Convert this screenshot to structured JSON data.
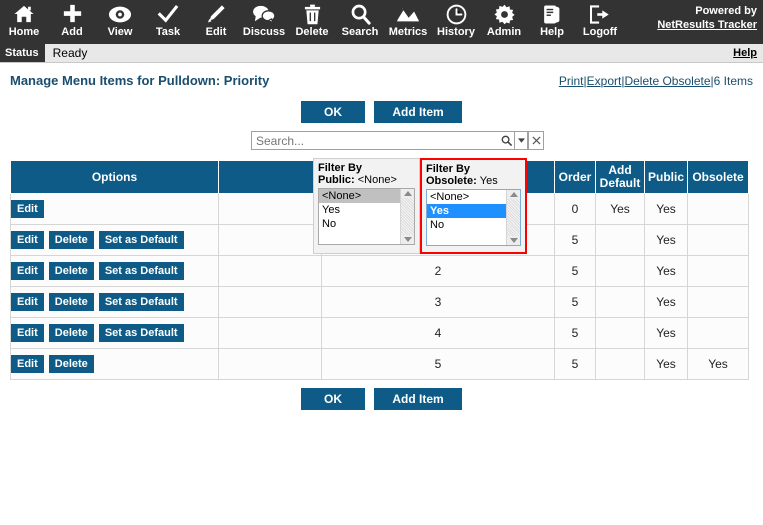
{
  "toolbar": {
    "items": [
      {
        "label": "Home",
        "icon": "home-icon"
      },
      {
        "label": "Add",
        "icon": "plus-icon"
      },
      {
        "label": "View",
        "icon": "eye-icon"
      },
      {
        "label": "Task",
        "icon": "check-icon"
      },
      {
        "label": "Edit",
        "icon": "pencil-icon"
      },
      {
        "label": "Discuss",
        "icon": "speech-bubbles-icon"
      },
      {
        "label": "Delete",
        "icon": "trash-icon"
      },
      {
        "label": "Search",
        "icon": "magnifier-icon"
      },
      {
        "label": "Metrics",
        "icon": "chart-line-icon"
      },
      {
        "label": "History",
        "icon": "clock-icon"
      },
      {
        "label": "Admin",
        "icon": "gear-icon"
      },
      {
        "label": "Help",
        "icon": "book-icon"
      },
      {
        "label": "Logoff",
        "icon": "logout-icon"
      }
    ],
    "powered_by": "Powered by",
    "brand": "NetResults Tracker"
  },
  "statusbar": {
    "label": "Status",
    "text": "Ready",
    "help": "Help"
  },
  "header": {
    "title": "Manage Menu Items for Pulldown: Priority",
    "links": [
      {
        "label": "Print",
        "type": "link"
      },
      {
        "label": "|",
        "type": "sep"
      },
      {
        "label": "Export",
        "type": "link"
      },
      {
        "label": "|",
        "type": "sep"
      },
      {
        "label": "Delete Obsolete",
        "type": "link"
      },
      {
        "label": "|",
        "type": "sep"
      },
      {
        "label": "6 Items",
        "type": "count"
      }
    ]
  },
  "buttons": {
    "ok": "OK",
    "add_item": "Add Item"
  },
  "search": {
    "placeholder": "Search...",
    "value": "",
    "search_icon": "magnifier-icon",
    "dropdown_icon": "chevron-down-icon",
    "clear_icon": "close-icon"
  },
  "table": {
    "columns": [
      "Options",
      "",
      "",
      "Order",
      "Add Default",
      "Public",
      "Obsolete"
    ],
    "headers": {
      "options": "Options",
      "blank1": "",
      "value": "",
      "order": "Order",
      "add_default_line1": "Add",
      "add_default_line2": "Default",
      "public": "Public",
      "obsolete": "Obsolete"
    },
    "row_buttons": {
      "edit": "Edit",
      "delete": "Delete",
      "set_default": "Set as Default"
    },
    "rows": [
      {
        "buttons": [
          "Edit"
        ],
        "value": "",
        "order": "0",
        "add_default": "Yes",
        "public": "Yes",
        "obsolete": ""
      },
      {
        "buttons": [
          "Edit",
          "Delete",
          "Set as Default"
        ],
        "value": "",
        "order": "5",
        "add_default": "",
        "public": "Yes",
        "obsolete": ""
      },
      {
        "buttons": [
          "Edit",
          "Delete",
          "Set as Default"
        ],
        "value": "2",
        "order": "5",
        "add_default": "",
        "public": "Yes",
        "obsolete": ""
      },
      {
        "buttons": [
          "Edit",
          "Delete",
          "Set as Default"
        ],
        "value": "3",
        "order": "5",
        "add_default": "",
        "public": "Yes",
        "obsolete": ""
      },
      {
        "buttons": [
          "Edit",
          "Delete",
          "Set as Default"
        ],
        "value": "4",
        "order": "5",
        "add_default": "",
        "public": "Yes",
        "obsolete": ""
      },
      {
        "buttons": [
          "Edit",
          "Delete"
        ],
        "value": "5",
        "order": "5",
        "add_default": "",
        "public": "Yes",
        "obsolete": "Yes"
      }
    ]
  },
  "filters": {
    "public": {
      "label_line1": "Filter By",
      "label_line2": "Public:",
      "selected_display": "<None>",
      "options": [
        "<None>",
        "Yes",
        "No"
      ],
      "selected_index": 0
    },
    "obsolete": {
      "label_line1": "Filter By",
      "label_line2": "Obsolete:",
      "selected_display": "Yes",
      "options": [
        "<None>",
        "Yes",
        "No"
      ],
      "selected_index": 1,
      "highlight_color": "#ff0000"
    }
  },
  "colors": {
    "toolbar_bg": "#333333",
    "accent": "#0d5b86",
    "title": "#1a4e6e",
    "selection_blue": "#1e90ff",
    "highlight_red": "#ff0000"
  }
}
